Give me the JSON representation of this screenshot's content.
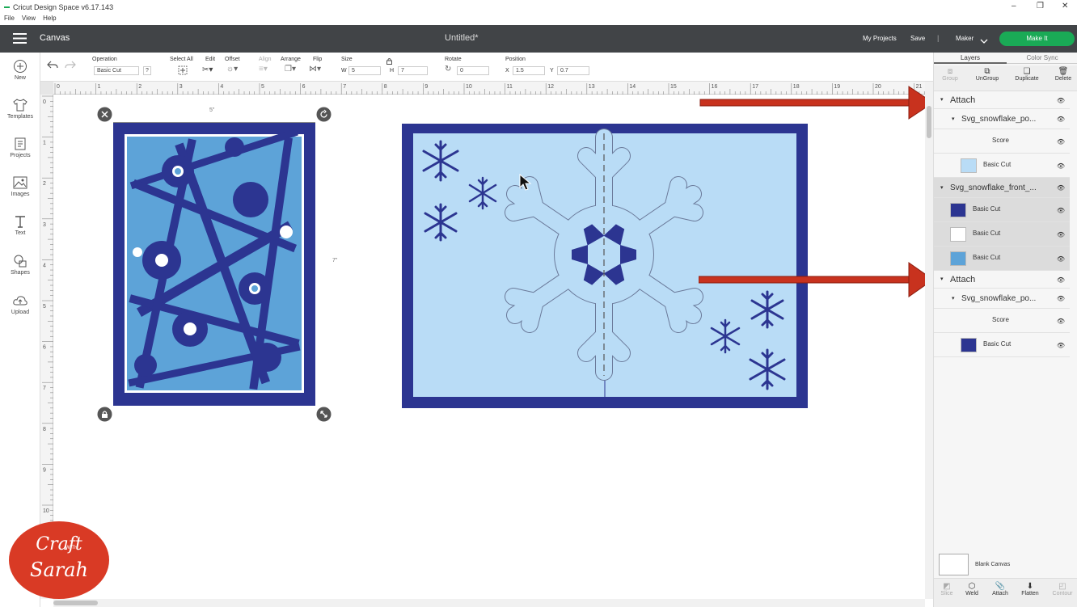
{
  "window": {
    "title": "Cricut Design Space  v6.17.143",
    "controls": [
      "–",
      "❐",
      "✕"
    ]
  },
  "menu": [
    "File",
    "View",
    "Help"
  ],
  "header": {
    "section": "Canvas",
    "project_name": "Untitled*",
    "my_projects": "My Projects",
    "save": "Save",
    "separator": "|",
    "machine": "Maker",
    "make_it": "Make It",
    "make_it_color": "#1aaa56"
  },
  "toolbar": {
    "operation_label": "Operation",
    "operation_value": "Basic Cut",
    "operation_help": "?",
    "select_all": "Select All",
    "edit": "Edit",
    "offset": "Offset",
    "align": "Align",
    "arrange": "Arrange",
    "flip": "Flip",
    "size": "Size",
    "w_label": "W",
    "w_value": "5",
    "h_label": "H",
    "h_value": "7",
    "rotate": "Rotate",
    "rotate_value": "0",
    "position": "Position",
    "x_label": "X",
    "x_value": "1.5",
    "y_label": "Y",
    "y_value": "0.7"
  },
  "left_nav": [
    {
      "label": "New",
      "icon": "plus-circle-icon"
    },
    {
      "label": "Templates",
      "icon": "tshirt-icon"
    },
    {
      "label": "Projects",
      "icon": "projects-icon"
    },
    {
      "label": "Images",
      "icon": "image-icon"
    },
    {
      "label": "Text",
      "icon": "text-icon"
    },
    {
      "label": "Shapes",
      "icon": "shapes-icon"
    },
    {
      "label": "Upload",
      "icon": "upload-icon"
    }
  ],
  "ruler": {
    "h_ticks": [
      "0",
      "1",
      "2",
      "3",
      "4",
      "5",
      "6",
      "7",
      "8",
      "9",
      "10",
      "11",
      "12",
      "13",
      "14",
      "15",
      "16",
      "17",
      "18",
      "19",
      "20",
      "21"
    ],
    "v_ticks": [
      "0",
      "1",
      "2",
      "3",
      "4",
      "5",
      "6",
      "7",
      "8",
      "9",
      "10",
      "11"
    ]
  },
  "canvas": {
    "width_label": "5\"",
    "height_label": "7\""
  },
  "panel": {
    "tabs": [
      "Layers",
      "Color Sync"
    ],
    "actions": [
      "Group",
      "UnGroup",
      "Duplicate",
      "Delete"
    ],
    "layers": [
      {
        "name": "Attach",
        "level": 0,
        "arrow": true
      },
      {
        "name": "Svg_snowflake_po...",
        "level": 1
      },
      {
        "name": "Score",
        "level": 2
      },
      {
        "name": "Basic Cut",
        "level": 2,
        "thumb": "#b9dcf6"
      },
      {
        "name": "Svg_snowflake_front_...",
        "level": 0,
        "selected": true
      },
      {
        "name": "Basic Cut",
        "level": 1,
        "thumb": "#2c3591",
        "selected": true
      },
      {
        "name": "Basic Cut",
        "level": 1,
        "thumb": "#ffffff",
        "selected": true
      },
      {
        "name": "Basic Cut",
        "level": 1,
        "thumb": "#5da3d8",
        "selected": true
      },
      {
        "name": "Attach",
        "level": 0,
        "arrow": true
      },
      {
        "name": "Svg_snowflake_po...",
        "level": 1
      },
      {
        "name": "Score",
        "level": 2
      },
      {
        "name": "Basic Cut",
        "level": 2,
        "thumb": "#2c3591"
      }
    ],
    "blank_canvas": "Blank Canvas",
    "bottom_actions": [
      "Slice",
      "Weld",
      "Attach",
      "Flatten",
      "Contour"
    ]
  },
  "watermark": {
    "line1": "Craft",
    "line2": "WITH",
    "line3": "Sarah"
  },
  "colors": {
    "navy": "#2c3591",
    "light_blue": "#b9dcf6",
    "mid_blue": "#5da3d8",
    "arrow_red": "#c8321e"
  }
}
